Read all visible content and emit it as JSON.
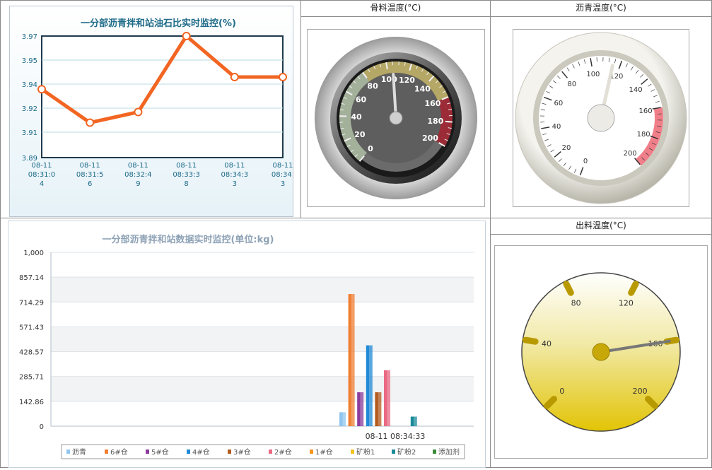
{
  "ratio_chart": {
    "title": "一分部沥青拌和站油石比实时监控(%)",
    "chart_data": {
      "type": "line",
      "title": "一分部沥青拌和站油石比实时监控(%)",
      "categories": [
        [
          "08-11",
          "08:31:0",
          "4"
        ],
        [
          "08-11",
          "08:31:5",
          "6"
        ],
        [
          "08-11",
          "08:32:4",
          "9"
        ],
        [
          "08-11",
          "08:33:3",
          "8"
        ],
        [
          "08-11",
          "08:34:3",
          "3"
        ],
        [
          "08-11",
          "08:34:",
          "3"
        ]
      ],
      "values": [
        3.935,
        3.913,
        3.92,
        3.97,
        3.943,
        3.943
      ],
      "yticks": [
        "3.97",
        "3.95",
        "3.94",
        "3.92",
        "3.91",
        "3.89"
      ],
      "ylim": [
        3.89,
        3.97
      ],
      "color": "#f26522"
    }
  },
  "gauges": {
    "aggregate": {
      "title": "骨料温度(°C)",
      "labels": [
        "0",
        "20",
        "40",
        "60",
        "80",
        "100",
        "120",
        "140",
        "160",
        "180",
        "200"
      ],
      "value": 105
    },
    "asphalt": {
      "title": "沥青温度(°C)",
      "labels": [
        "0",
        "20",
        "40",
        "60",
        "80",
        "100",
        "120",
        "140",
        "160",
        "180",
        "200"
      ],
      "value": 115
    },
    "output": {
      "title": "出料温度(°C)",
      "labels": [
        "0",
        "40",
        "80",
        "120",
        "160",
        "200"
      ],
      "value": 160
    }
  },
  "data_chart": {
    "title": "一分部沥青拌和站数据实时监控(单位:kg)",
    "chart_data": {
      "type": "bar",
      "title": "一分部沥青拌和站数据实时监控(单位:kg)",
      "categories": [
        "08-11 08:34:33"
      ],
      "yticks": [
        "1,000",
        "857.14",
        "714.29",
        "571.43",
        "428.57",
        "285.71",
        "142.86",
        "0"
      ],
      "ylim": [
        0,
        1000
      ],
      "series": [
        {
          "name": "沥青",
          "values": [
            80
          ],
          "color": "#8fc5ee"
        },
        {
          "name": "6#仓",
          "values": [
            760
          ],
          "color": "#f07f34"
        },
        {
          "name": "5#仓",
          "values": [
            195
          ],
          "color": "#8a3c9c"
        },
        {
          "name": "4#仓",
          "values": [
            465
          ],
          "color": "#2189d6"
        },
        {
          "name": "3#仓",
          "values": [
            195
          ],
          "color": "#b35a1f"
        },
        {
          "name": "2#仓",
          "values": [
            322
          ],
          "color": "#ea6a84"
        },
        {
          "name": "1#仓",
          "values": [
            0
          ],
          "color": "#f7941d"
        },
        {
          "name": "矿粉1",
          "values": [
            0
          ],
          "color": "#f4c21e"
        },
        {
          "name": "矿粉2",
          "values": [
            55
          ],
          "color": "#1a8a99"
        },
        {
          "name": "添加剂",
          "values": [
            0
          ],
          "color": "#3a8a3a"
        }
      ]
    }
  }
}
